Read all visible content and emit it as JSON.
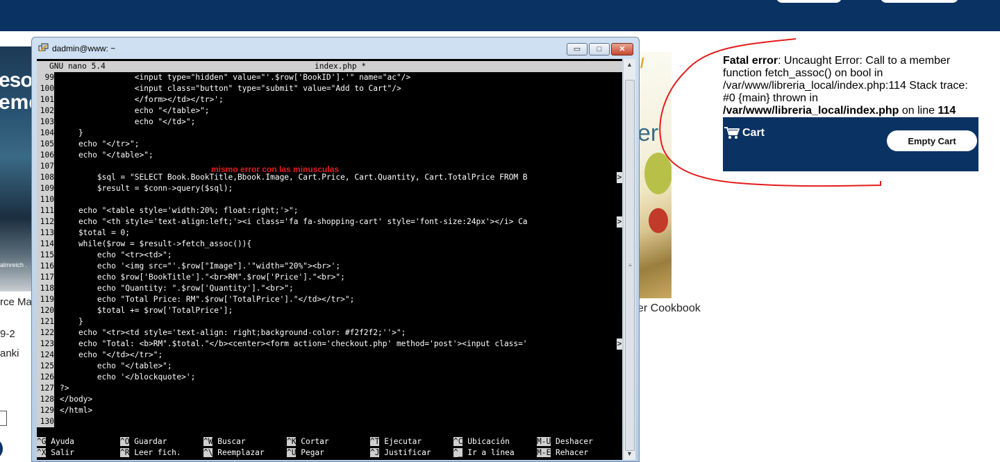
{
  "window": {
    "title": "dadmin@www: ~",
    "buttons": {
      "minimize": "▭",
      "maximize": "□",
      "close": "✕"
    }
  },
  "nano": {
    "version": "GNU nano 5.4",
    "filename": "index.php *"
  },
  "code_lines": [
    {
      "n": "99",
      "text": "                <input type=\"hidden\" value=\"'.$row['BookID'].'\" name=\"ac\"/>",
      "truncated": false
    },
    {
      "n": "100",
      "text": "                <input class=\"button\" type=\"submit\" value=\"Add to Cart\"/>",
      "truncated": false
    },
    {
      "n": "101",
      "text": "                </form></td></tr>';",
      "truncated": false
    },
    {
      "n": "102",
      "text": "                echo \"</table>\";",
      "truncated": false
    },
    {
      "n": "103",
      "text": "                echo \"</td>\";",
      "truncated": false
    },
    {
      "n": "104",
      "text": "    }",
      "truncated": false
    },
    {
      "n": "105",
      "text": "    echo \"</tr>\";",
      "truncated": false
    },
    {
      "n": "106",
      "text": "    echo \"</table>\";",
      "truncated": false
    },
    {
      "n": "107",
      "text": "",
      "truncated": false
    },
    {
      "n": "108",
      "text": "        $sql = \"SELECT Book.BookTitle,Bbook.Image, Cart.Price, Cart.Quantity, Cart.TotalPrice FROM B",
      "truncated": true
    },
    {
      "n": "109",
      "text": "        $result = $conn->query($sql);",
      "truncated": false
    },
    {
      "n": "110",
      "text": "",
      "truncated": false
    },
    {
      "n": "111",
      "text": "    echo \"<table style='width:20%; float:right;'>\";",
      "truncated": false
    },
    {
      "n": "112",
      "text": "    echo \"<th style='text-align:left;'><i class='fa fa-shopping-cart' style='font-size:24px'></i> Ca",
      "truncated": true
    },
    {
      "n": "113",
      "text": "    $total = 0;",
      "truncated": false
    },
    {
      "n": "114",
      "text": "    while($row = $result->fetch_assoc()){",
      "truncated": false
    },
    {
      "n": "115",
      "text": "        echo \"<tr><td>\";",
      "truncated": false
    },
    {
      "n": "116",
      "text": "        echo '<img src=\"'.$row[\"Image\"].'\"width=\"20%\"><br>';",
      "truncated": false
    },
    {
      "n": "117",
      "text": "        echo $row['BookTitle'].\"<br>RM\".$row['Price'].\"<br>\";",
      "truncated": false
    },
    {
      "n": "118",
      "text": "        echo \"Quantity: \".$row['Quantity'].\"<br>\";",
      "truncated": false
    },
    {
      "n": "119",
      "text": "        echo \"Total Price: RM\".$row['TotalPrice'].\"</td></tr>\";",
      "truncated": false
    },
    {
      "n": "120",
      "text": "        $total += $row['TotalPrice'];",
      "truncated": false
    },
    {
      "n": "121",
      "text": "    }",
      "truncated": false
    },
    {
      "n": "122",
      "text": "    echo \"<tr><td style='text-align: right;background-color: #f2f2f2;''>\";",
      "truncated": false
    },
    {
      "n": "123",
      "text": "    echo \"Total: <b>RM\".$total.\"</b><center><form action='checkout.php' method='post'><input class='",
      "truncated": true
    },
    {
      "n": "124",
      "text": "    echo \"</td></tr>\";",
      "truncated": false
    },
    {
      "n": "125",
      "text": "        echo \"</table>\";",
      "truncated": false
    },
    {
      "n": "126",
      "text": "        echo '</blockquote>';",
      "truncated": false
    },
    {
      "n": "127",
      "text": "?>",
      "truncated": false
    },
    {
      "n": "128",
      "text": "</body>",
      "truncated": false
    },
    {
      "n": "129",
      "text": "</html>",
      "truncated": false
    },
    {
      "n": "130",
      "text": "",
      "truncated": false
    }
  ],
  "truncation_marker": ">",
  "annotation": "mismo error con las minusculas",
  "shortcuts": [
    {
      "key": "^G",
      "label": "Ayuda"
    },
    {
      "key": "^O",
      "label": "Guardar"
    },
    {
      "key": "^W",
      "label": "Buscar"
    },
    {
      "key": "^K",
      "label": "Cortar"
    },
    {
      "key": "^T",
      "label": "Ejecutar"
    },
    {
      "key": "^C",
      "label": "Ubicación"
    },
    {
      "key": "M-U",
      "label": "Deshacer"
    },
    {
      "key": "^X",
      "label": "Salir"
    },
    {
      "key": "^R",
      "label": "Leer fich."
    },
    {
      "key": "^\\",
      "label": "Reemplazar"
    },
    {
      "key": "^U",
      "label": "Pegar"
    },
    {
      "key": "^J",
      "label": "Justificar"
    },
    {
      "key": "^_",
      "label": "Ir a línea"
    },
    {
      "key": "M-E",
      "label": "Rehacer"
    }
  ],
  "page": {
    "left_book_words": [
      "esou",
      "eme",
      "almreich ."
    ],
    "left_texts": [
      "rce Ma",
      "9-2",
      "anki"
    ],
    "right_book_word": "er",
    "right_caption": "er Cookbook",
    "fatal_error": {
      "label": "Fatal error",
      "message": ": Uncaught Error: Call to a member function fetch_assoc() on bool in /var/www/libreria_local/index.php:114 Stack trace: #0 {main} thrown in ",
      "path": "/var/www/libreria_local/index.php",
      "on_line": " on line ",
      "line": "114"
    },
    "cart": {
      "label": "Cart",
      "empty_button": "Empty Cart"
    }
  },
  "colors": {
    "navbar": "#0a3263",
    "annotation_red": "#e41b1b",
    "cursor_green": "#2ad12a"
  }
}
